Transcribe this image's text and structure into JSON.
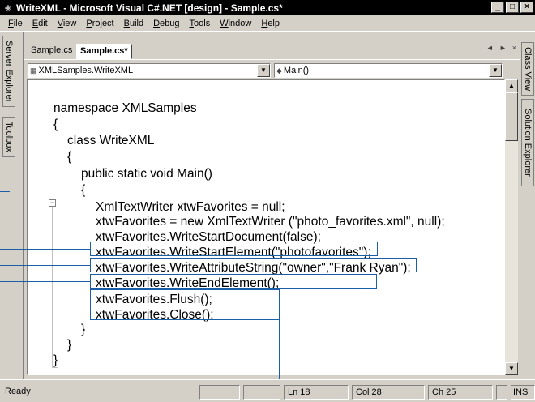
{
  "window": {
    "title": "WriteXML - Microsoft Visual C#.NET [design] - Sample.cs*",
    "buttons": {
      "minimize": "_",
      "maximize": "□",
      "close": "×"
    }
  },
  "menubar": {
    "items": [
      "File",
      "Edit",
      "View",
      "Project",
      "Build",
      "Debug",
      "Tools",
      "Window",
      "Help"
    ]
  },
  "left_dock": {
    "tabs": [
      "Server Explorer",
      "Toolbox"
    ]
  },
  "right_dock": {
    "tabs": [
      "Class View",
      "Solution Explorer"
    ]
  },
  "editor": {
    "tabs": [
      {
        "label": "Sample.cs",
        "active": false
      },
      {
        "label": "Sample.cs*",
        "active": true
      }
    ],
    "tab_nav": {
      "prev": "◄",
      "next": "►",
      "close": "×"
    },
    "type_combo": {
      "value": "XMLSamples.WriteXML",
      "icon": "class-icon"
    },
    "member_combo": {
      "value": "Main()",
      "icon": "method-icon"
    },
    "collapse_glyph": "−",
    "code_lines": [
      "namespace XMLSamples",
      "{",
      "class WriteXML",
      "{",
      "public static void Main()",
      "{",
      "XmlTextWriter xtwFavorites = null;",
      "xtwFavorites = new XmlTextWriter (\"photo_favorites.xml\", null);",
      "xtwFavorites.WriteStartDocument(false);",
      "xtwFavorites.WriteStartElement(\"photofavorites\");",
      "xtwFavorites.WriteAttributeString(\"owner\",\"Frank Ryan\");",
      "xtwFavorites.WriteEndElement();",
      "xtwFavorites.Flush();",
      "xtwFavorites.Close();",
      "}",
      "}",
      "}"
    ]
  },
  "statusbar": {
    "ready": "Ready",
    "line": "Ln 18",
    "col": "Col 28",
    "ch": "Ch 25",
    "mode": "INS"
  },
  "colors": {
    "callout": "#1a5ea8",
    "chrome": "#d4d0c8",
    "titlebar": "#000000"
  }
}
